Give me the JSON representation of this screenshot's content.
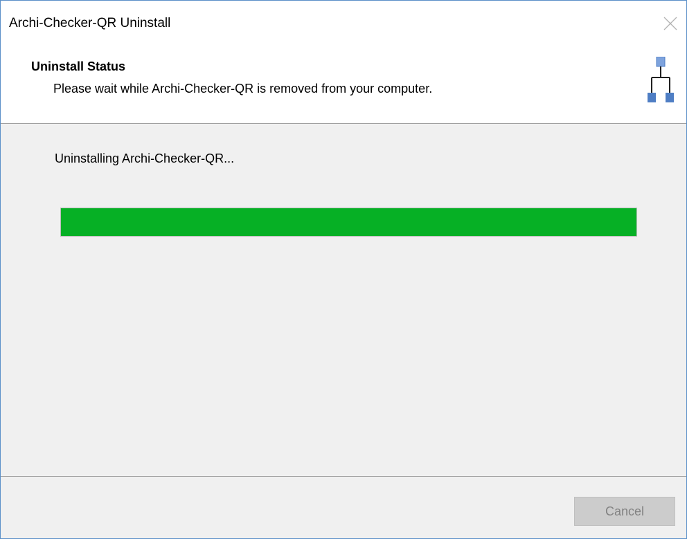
{
  "window": {
    "title": "Archi-Checker-QR Uninstall"
  },
  "header": {
    "title": "Uninstall Status",
    "subtitle": "Please wait while Archi-Checker-QR is removed from your computer.",
    "icon": "network-hierarchy-icon"
  },
  "main": {
    "status": "Uninstalling Archi-Checker-QR...",
    "progress_percent": 100
  },
  "footer": {
    "cancel_label": "Cancel",
    "cancel_enabled": false
  },
  "colors": {
    "window_border": "#5a8fc8",
    "progress_fill": "#06b025",
    "icon_blue": "#4f7ec4",
    "icon_light_blue": "#7ea3dd",
    "icon_line": "#202020"
  },
  "icons": {
    "close": "close-icon"
  }
}
